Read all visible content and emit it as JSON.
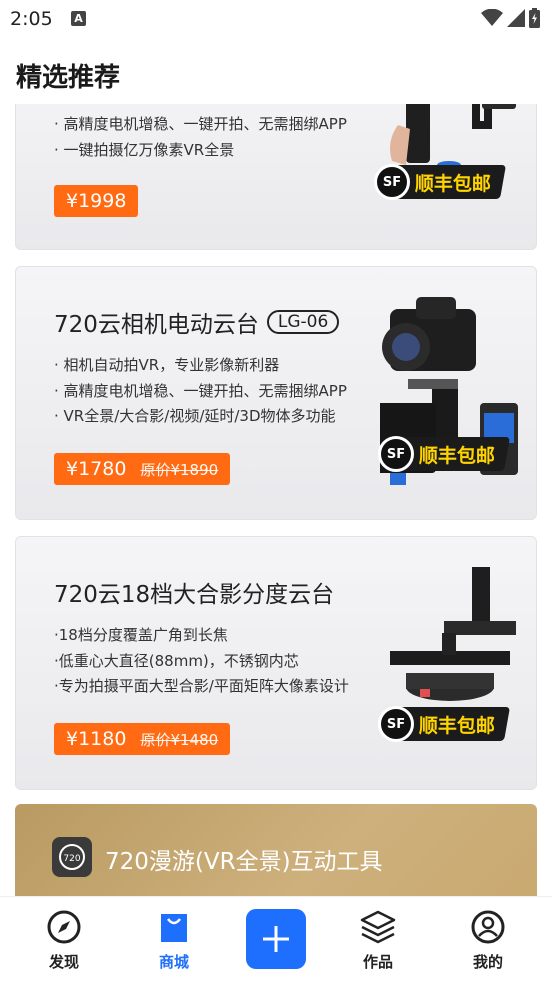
{
  "status_bar": {
    "time": "2:05",
    "notification_badge": "A"
  },
  "header": {
    "title": "精选推荐"
  },
  "cards": [
    {
      "features": [
        "· 高精度电机增稳、一键开拍、无需捆绑APP",
        "· 一键拍摄亿万像素VR全景"
      ],
      "price": "¥1998",
      "shipping": {
        "logo": "SF",
        "text": "顺丰包邮"
      }
    },
    {
      "title": "720云相机电动云台",
      "model": "LG-06",
      "features": [
        "· 相机自动拍VR，专业影像新利器",
        "· 高精度电机增稳、一键开拍、无需捆绑APP",
        "· VR全景/大合影/视频/延时/3D物体多功能"
      ],
      "price": "¥1780",
      "original_price": "原价¥1890",
      "shipping": {
        "logo": "SF",
        "text": "顺丰包邮"
      }
    },
    {
      "title": "720云18档大合影分度云台",
      "features": [
        "·18档分度覆盖广角到长焦",
        "·低重心大直径(88mm)，不锈钢内芯",
        "·专为拍摄平面大型合影/平面矩阵大像素设计"
      ],
      "price": "¥1180",
      "original_price": "原价¥1480",
      "shipping": {
        "logo": "SF",
        "text": "顺丰包邮"
      }
    }
  ],
  "promo": {
    "icon_text": "720",
    "title": "720漫游(VR全景)互动工具"
  },
  "bottom_nav": {
    "items": [
      {
        "label": "发现",
        "icon": "compass-icon"
      },
      {
        "label": "商城",
        "icon": "shopping-bag-icon",
        "active": true
      },
      {
        "label": "作品",
        "icon": "layers-icon"
      },
      {
        "label": "我的",
        "icon": "profile-icon"
      }
    ],
    "add_icon": "plus-icon"
  },
  "colors": {
    "accent": "#1f6fff",
    "price": "#ff6a13",
    "sf_yellow": "#ffd400"
  }
}
